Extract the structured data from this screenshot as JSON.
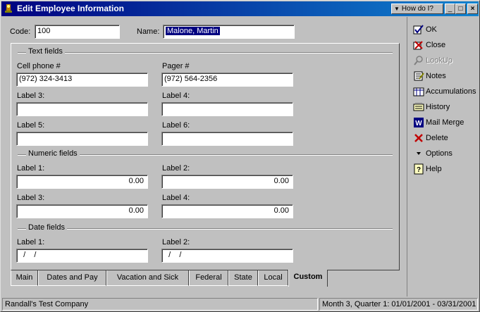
{
  "window": {
    "title": "Edit Employee Information",
    "howdoi_label": "How do I?",
    "min_glyph": "_",
    "max_glyph": "□",
    "close_glyph": "×"
  },
  "header": {
    "code_label": "Code:",
    "code_value": "100",
    "name_label": "Name:",
    "name_value": "Malone, Martin"
  },
  "text_fields": {
    "group_title": "Text fields",
    "items": [
      {
        "label": "Cell phone #",
        "value": "(972) 324-3413"
      },
      {
        "label": "Pager #",
        "value": "(972) 564-2356"
      },
      {
        "label": "Label 3:",
        "value": ""
      },
      {
        "label": "Label 4:",
        "value": ""
      },
      {
        "label": "Label 5:",
        "value": ""
      },
      {
        "label": "Label 6:",
        "value": ""
      }
    ]
  },
  "numeric_fields": {
    "group_title": "Numeric fields",
    "items": [
      {
        "label": "Label 1:",
        "value": "0.00"
      },
      {
        "label": "Label 2:",
        "value": "0.00"
      },
      {
        "label": "Label 3:",
        "value": "0.00"
      },
      {
        "label": "Label 4:",
        "value": "0.00"
      }
    ]
  },
  "date_fields": {
    "group_title": "Date fields",
    "items": [
      {
        "label": "Label 1:",
        "value": "  /    /"
      },
      {
        "label": "Label 2:",
        "value": "  /    /"
      }
    ]
  },
  "tabs": [
    {
      "label": "Main"
    },
    {
      "label": "Dates and Pay"
    },
    {
      "label": "Vacation and Sick"
    },
    {
      "label": "Federal"
    },
    {
      "label": "State"
    },
    {
      "label": "Local"
    },
    {
      "label": "Custom",
      "active": true
    }
  ],
  "sidebar": {
    "items": [
      {
        "label": "OK",
        "icon": "ok-check-icon"
      },
      {
        "label": "Close",
        "icon": "close-x-icon"
      },
      {
        "label": "LookUp",
        "icon": "lookup-magnifier-icon",
        "disabled": true
      },
      {
        "label": "Notes",
        "icon": "notes-icon"
      },
      {
        "label": "Accumulations",
        "icon": "accumulations-icon"
      },
      {
        "label": "History",
        "icon": "history-icon"
      },
      {
        "label": "Mail Merge",
        "icon": "word-icon"
      },
      {
        "label": "Delete",
        "icon": "delete-x-icon"
      },
      {
        "label": "Options",
        "icon": "dropdown-arrow-icon"
      },
      {
        "label": "Help",
        "icon": "help-icon"
      }
    ]
  },
  "status": {
    "company": "Randall's Test Company",
    "period": "Month 3, Quarter 1: 01/01/2001 - 03/31/2001"
  },
  "colors": {
    "titlebar": "#000080",
    "face": "#c0c0c0",
    "selection": "#000080"
  }
}
